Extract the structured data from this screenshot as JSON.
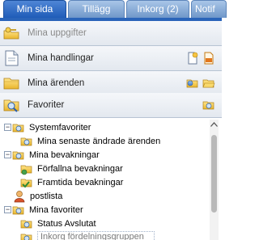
{
  "tabs": [
    {
      "label": "Min sida",
      "active": true
    },
    {
      "label": "Tillägg",
      "active": false
    },
    {
      "label": "Inkorg (2)",
      "active": false
    },
    {
      "label": "Notif",
      "active": false
    }
  ],
  "sections": [
    {
      "label": "Mina uppgifter",
      "icon": "key-folder-icon",
      "disabled": true
    },
    {
      "label": "Mina handlingar",
      "icon": "document-icon",
      "actions": [
        "new-document-icon",
        "pdf-document-icon"
      ]
    },
    {
      "label": "Mina ärenden",
      "icon": "folder-icon",
      "actions": [
        "folder-search-icon",
        "folder-open-icon"
      ]
    },
    {
      "label": "Favoriter",
      "icon": "favorites-magnifier-icon",
      "actions": [
        "favorites-folder-icon"
      ]
    }
  ],
  "tree": {
    "nodes": [
      {
        "label": "Systemfavoriter",
        "level": 0,
        "expanded": true,
        "icon": "favorites-folder-icon"
      },
      {
        "label": "Mina senaste ändrade ärenden",
        "level": 1,
        "icon": "favorites-folder-icon"
      },
      {
        "label": "Mina bevakningar",
        "level": 0,
        "expanded": true,
        "icon": "favorites-folder-icon"
      },
      {
        "label": "Förfallna bevakningar",
        "level": 1,
        "icon": "overdue-watch-icon"
      },
      {
        "label": "Framtida bevakningar",
        "level": 1,
        "icon": "future-watch-icon"
      },
      {
        "label": "postlista",
        "level": 0,
        "icon": "user-list-icon"
      },
      {
        "label": "Mina favoriter",
        "level": 0,
        "expanded": true,
        "icon": "favorites-folder-icon"
      },
      {
        "label": "Status Avslutat",
        "level": 1,
        "icon": "favorites-folder-icon"
      },
      {
        "label": "Inkorg fördelningsgruppen",
        "level": 1,
        "icon": "favorites-folder-icon",
        "selected": true
      }
    ]
  },
  "colors": {
    "tab_active": "#1f5cb8",
    "tab_inactive": "#6f97c9",
    "section_bg": "#e3e8ef",
    "folder_yellow": "#f2c94c"
  }
}
